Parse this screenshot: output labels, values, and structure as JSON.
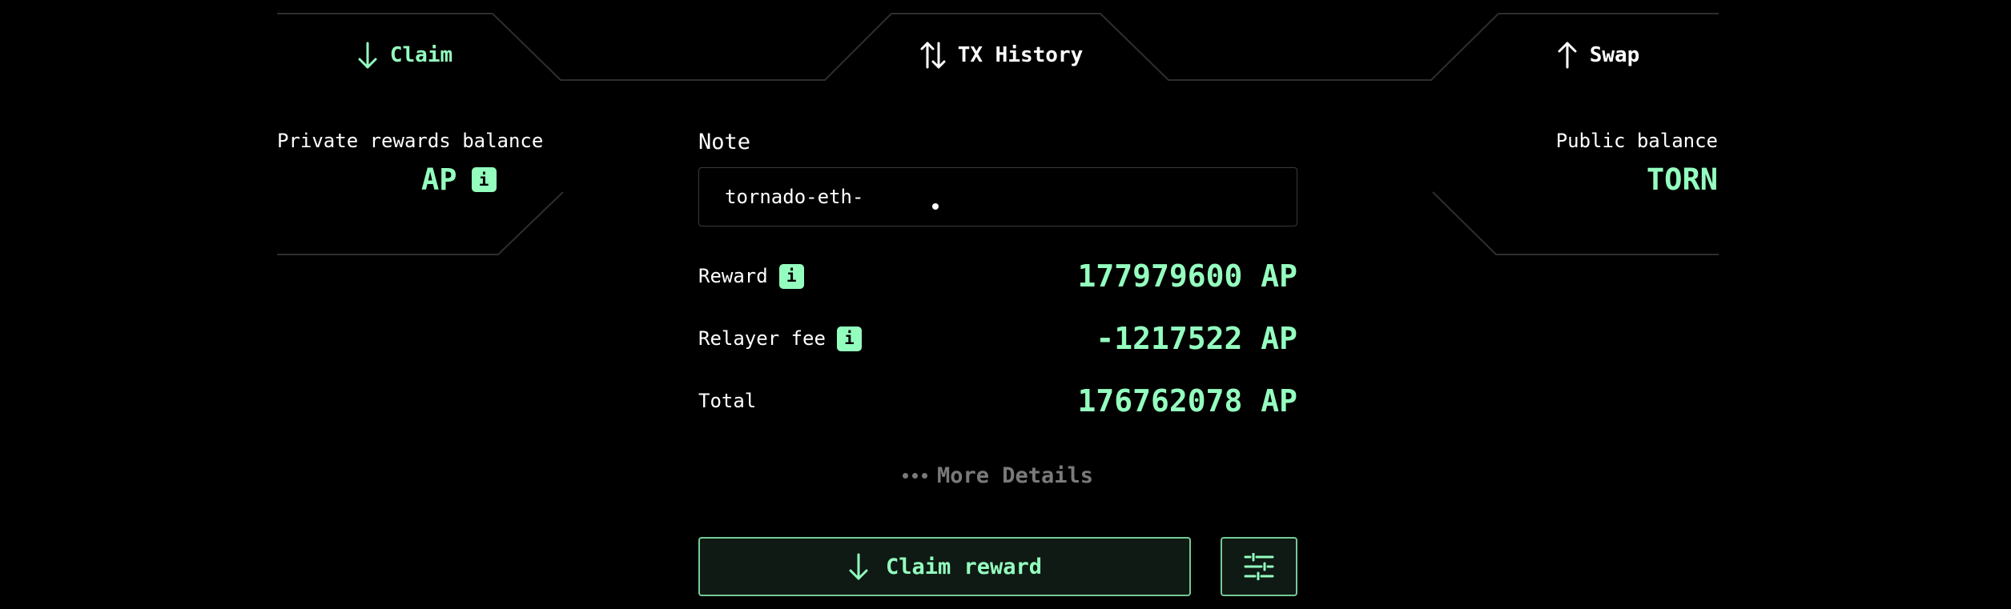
{
  "tabs": {
    "claim": "Claim",
    "history": "TX History",
    "swap": "Swap"
  },
  "private_balance": {
    "label": "Private rewards balance",
    "value": "AP"
  },
  "public_balance": {
    "label": "Public balance",
    "value": "TORN"
  },
  "note": {
    "label": "Note",
    "value": "tornado-eth-"
  },
  "rows": {
    "reward": {
      "label": "Reward",
      "value": "177979600 AP"
    },
    "fee": {
      "label": "Relayer fee",
      "value": "-1217522 AP"
    },
    "total": {
      "label": "Total",
      "value": "176762078 AP"
    }
  },
  "info_badge": "i",
  "more_details": "More Details",
  "claim_button": "Claim reward",
  "icons": {
    "claim_tab": "arrow-down-icon",
    "history_tab": "arrows-up-down-icon",
    "swap_tab": "arrow-up-icon",
    "claim_button": "arrow-down-icon",
    "settings_button": "sliders-icon"
  },
  "colors": {
    "accent": "#94FEBF",
    "button_border": "#74C997",
    "button_bg": "#0F1A14",
    "muted": "#7a7a7a",
    "outline": "#2e2e2e"
  }
}
